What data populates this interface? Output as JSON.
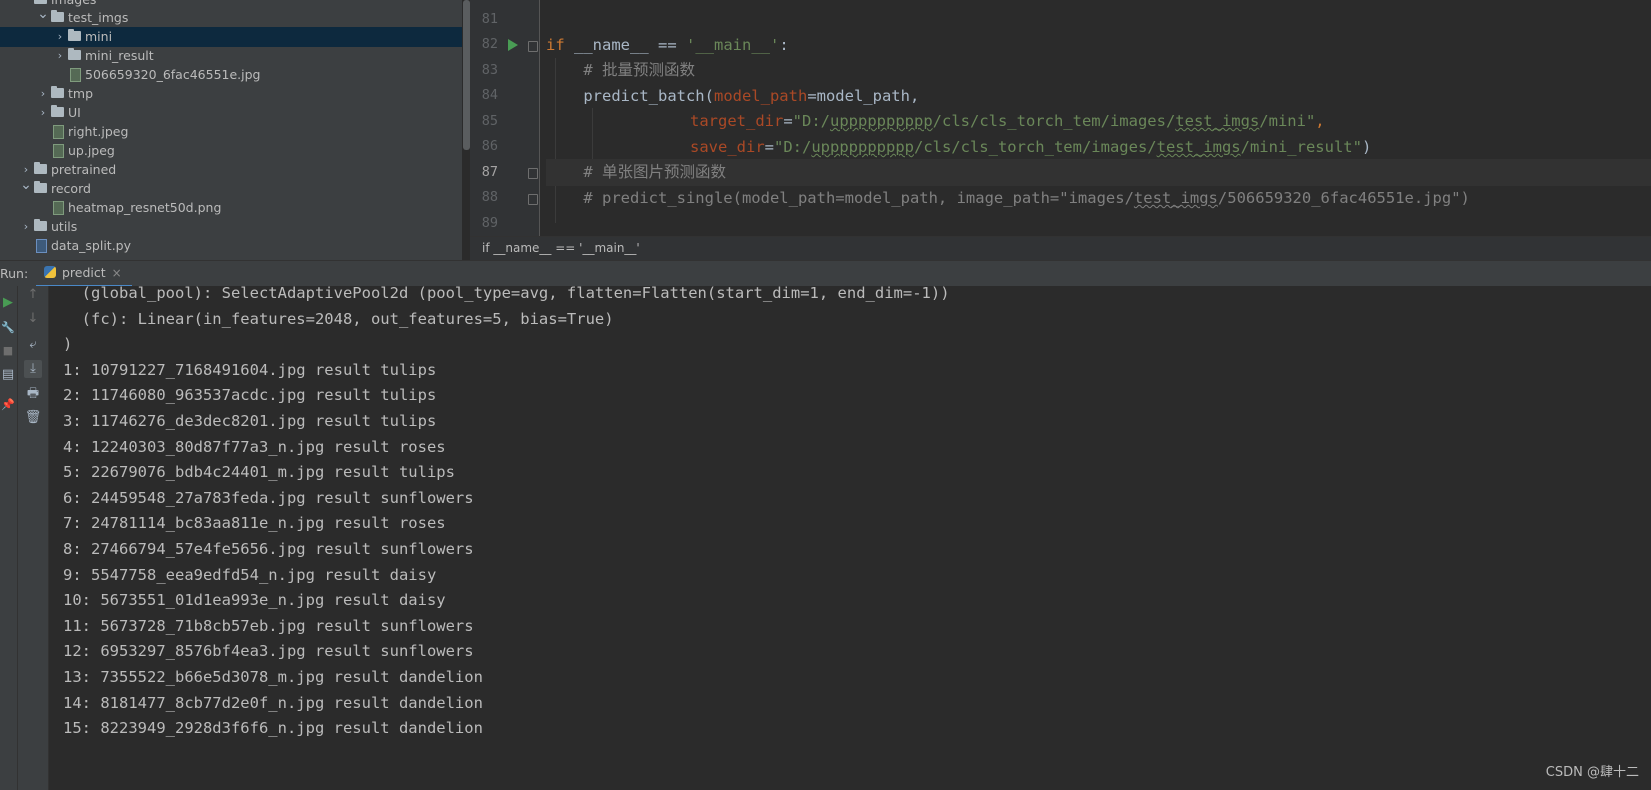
{
  "project_tree": {
    "items": [
      {
        "label": "images",
        "type": "folder",
        "expanded": true
      },
      {
        "label": "test_imgs",
        "type": "folder",
        "expanded": true
      },
      {
        "label": "mini",
        "type": "folder",
        "expanded": false,
        "selected": true
      },
      {
        "label": "mini_result",
        "type": "folder",
        "expanded": false
      },
      {
        "label": "506659320_6fac46551e.jpg",
        "type": "image-file"
      },
      {
        "label": "tmp",
        "type": "folder",
        "expanded": false
      },
      {
        "label": "UI",
        "type": "folder",
        "expanded": false
      },
      {
        "label": "right.jpeg",
        "type": "image-file"
      },
      {
        "label": "up.jpeg",
        "type": "image-file"
      },
      {
        "label": "pretrained",
        "type": "folder",
        "expanded": false
      },
      {
        "label": "record",
        "type": "folder",
        "expanded": true
      },
      {
        "label": "heatmap_resnet50d.png",
        "type": "image-file"
      },
      {
        "label": "utils",
        "type": "folder",
        "expanded": false
      },
      {
        "label": "data_split.py",
        "type": "python-file"
      }
    ]
  },
  "editor": {
    "line_numbers": [
      "81",
      "82",
      "83",
      "84",
      "85",
      "86",
      "87",
      "88",
      "89"
    ],
    "current_line": "87",
    "code": {
      "l82_if": "if",
      "l82_name": " __name__ == ",
      "l82_str": "'__main__'",
      "l82_colon": ":",
      "l83": "    # 批量预测函数",
      "l84_func": "    predict_batch(",
      "l84_param": "model_path",
      "l84_rest": "=model_path,",
      "l85_param": "target_dir",
      "l85_eq": "=",
      "l85_s1": "\"D:/",
      "l85_s2": "upppppppppp",
      "l85_s3": "/cls/cls_torch_tem/images/",
      "l85_s4": "test_imgs",
      "l85_s5": "/mini\"",
      "l85_comma": ",",
      "l86_param": "save_dir",
      "l86_eq": "=",
      "l86_s1": "\"D:/",
      "l86_s2": "upppppppppp",
      "l86_s3": "/cls/cls_torch_tem/images/",
      "l86_s4": "test_imgs",
      "l86_s5": "/mini_result\"",
      "l86_close": ")",
      "l87": "    # 单张图片预测函数",
      "l88_a": "    # predict_single(model_path=model_path, image_path=\"images/",
      "l88_b": "test_imgs",
      "l88_c": "/506659320_6fac46551e.jpg\")"
    },
    "breadcrumb": "if __name__ == '__main__'"
  },
  "run_panel": {
    "label": "Run:",
    "tab": "predict",
    "close_glyph": "×"
  },
  "console": {
    "lines": [
      "  (global_pool): SelectAdaptivePool2d (pool_type=avg, flatten=Flatten(start_dim=1, end_dim=-1))",
      "  (fc): Linear(in_features=2048, out_features=5, bias=True)",
      ")",
      "1: 10791227_7168491604.jpg result tulips",
      "2: 11746080_963537acdc.jpg result tulips",
      "3: 11746276_de3dec8201.jpg result tulips",
      "4: 12240303_80d87f77a3_n.jpg result roses",
      "5: 22679076_bdb4c24401_m.jpg result tulips",
      "6: 24459548_27a783feda.jpg result sunflowers",
      "7: 24781114_bc83aa811e_n.jpg result roses",
      "8: 27466794_57e4fe5656.jpg result sunflowers",
      "9: 5547758_eea9edfd54_n.jpg result daisy",
      "10: 5673551_01d1ea993e_n.jpg result daisy",
      "11: 5673728_71b8cb57eb.jpg result sunflowers",
      "12: 6953297_8576bf4ea3.jpg result sunflowers",
      "13: 7355522_b66e5d3078_m.jpg result dandelion",
      "14: 8181477_8cb77d2e0f_n.jpg result dandelion",
      "15: 8223949_2928d3f6f6_n.jpg result dandelion"
    ]
  },
  "watermark": "CSDN @肆十二",
  "icons": {
    "run": "▶",
    "wrench": "🔧",
    "stop": "■",
    "layout": "▤",
    "pin": "📌",
    "up": "↑",
    "down": "↓",
    "soft_wrap": "⤶",
    "scroll_end": "⤓",
    "print": "🖶",
    "trash": "🗑"
  },
  "colors": {
    "keyword": "#cc7832",
    "string": "#6a8759",
    "param": "#aa4926",
    "comment": "#808080",
    "selection": "#0d293e"
  }
}
